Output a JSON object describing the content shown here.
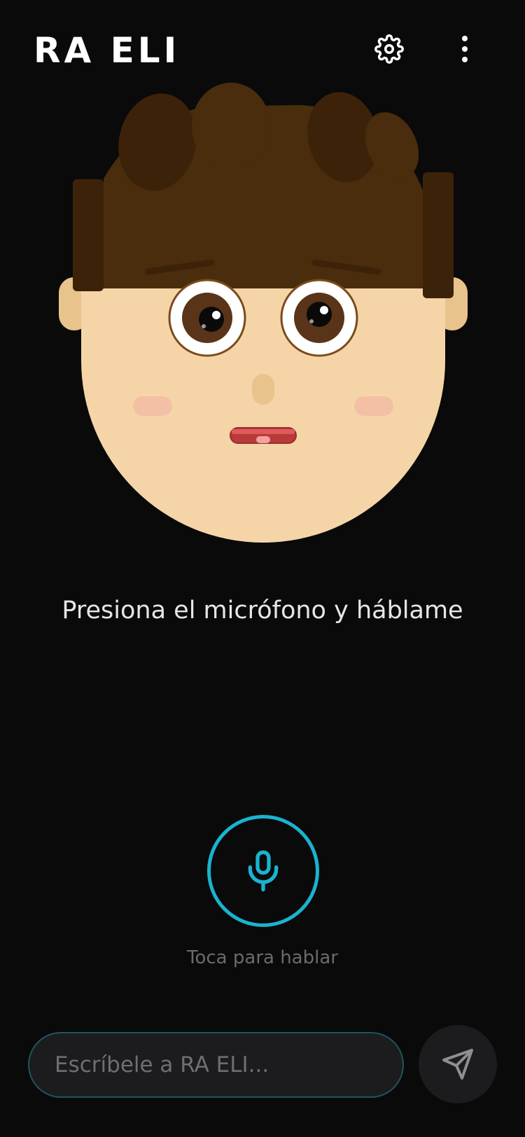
{
  "header": {
    "title": "RA ELI",
    "settings_icon": "gear-icon",
    "menu_icon": "more-vertical-icon"
  },
  "avatar": {
    "hair_color": "#4a2d0c",
    "skin_color": "#f5d5a8",
    "eye_color": "#5a3418"
  },
  "main": {
    "prompt": "Presiona el micrófono y háblame"
  },
  "voice": {
    "mic_icon": "microphone-icon",
    "hint": "Toca para hablar",
    "accent": "#1ab3cf"
  },
  "composer": {
    "placeholder": "Escríbele a RA ELI...",
    "send_icon": "send-icon"
  },
  "colors": {
    "background": "#0a0a0a",
    "surface": "#1c1c1e"
  }
}
